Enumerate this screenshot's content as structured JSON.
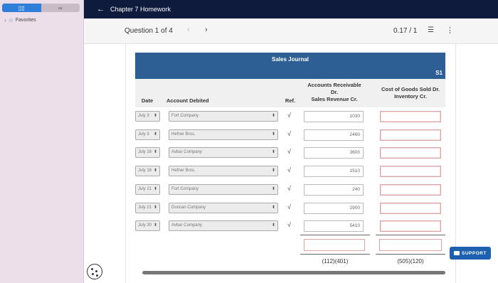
{
  "sidebar": {
    "favorites_label": "Favorites"
  },
  "topbar": {
    "title": "Chapter 7 Homework"
  },
  "question": {
    "label": "Question 1 of 4",
    "score": "0.17 / 1"
  },
  "journal": {
    "title": "Sales Journal",
    "page": "S1",
    "columns": {
      "date": "Date",
      "account": "Account Debited",
      "ref": "Ref.",
      "ar_line1": "Accounts Receivable",
      "ar_line2": "Dr.",
      "ar_line3": "Sales Revenue Cr.",
      "cogs_line1": "Cost of Goods Sold Dr.",
      "cogs_line2": "Inventory Cr."
    },
    "rows": [
      {
        "date": "July 3",
        "account": "Fort Company",
        "ref": "√",
        "amount": "1030",
        "cogs": ""
      },
      {
        "date": "July 3",
        "account": "Hefner Bros.",
        "ref": "√",
        "amount": "2460",
        "cogs": ""
      },
      {
        "date": "July 16",
        "account": "Avbar Company",
        "ref": "√",
        "amount": "3600",
        "cogs": ""
      },
      {
        "date": "July 16",
        "account": "Hefner Bros.",
        "ref": "√",
        "amount": "1510",
        "cogs": ""
      },
      {
        "date": "July 21",
        "account": "Fort Company",
        "ref": "√",
        "amount": "240",
        "cogs": ""
      },
      {
        "date": "July 21",
        "account": "Duncan Company",
        "ref": "√",
        "amount": "2900",
        "cogs": ""
      },
      {
        "date": "July 30",
        "account": "Avbar Company",
        "ref": "√",
        "amount": "5410",
        "cogs": ""
      }
    ],
    "totals": {
      "ar_accounts": "(112)(401)",
      "cogs_accounts": "(505)(120)"
    }
  },
  "support": {
    "label": "SUPPORT"
  },
  "colors": {
    "topbar": "#0e1b3d",
    "journal_header": "#2e5f94",
    "accent": "#2f7fd8",
    "support": "#1d5fb0"
  }
}
